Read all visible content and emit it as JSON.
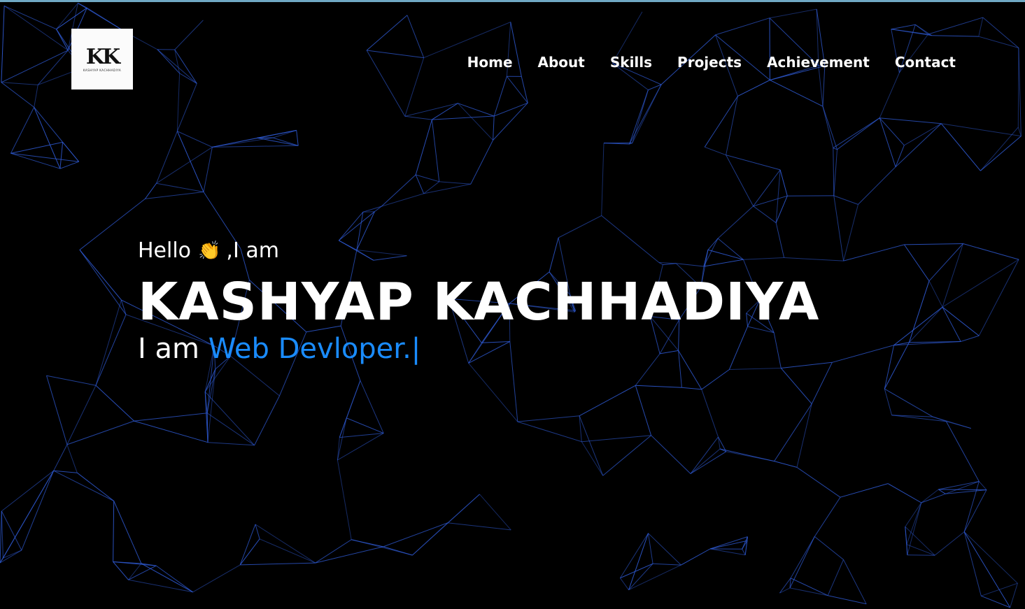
{
  "logo": {
    "mark": "KK",
    "subtitle": "KASHYAP KACHHADIYA"
  },
  "nav": {
    "items": [
      {
        "label": "Home"
      },
      {
        "label": "About"
      },
      {
        "label": "Skills"
      },
      {
        "label": "Projects"
      },
      {
        "label": "Achievement"
      },
      {
        "label": "Contact"
      }
    ]
  },
  "hero": {
    "greeting_before": "Hello",
    "greeting_icon": "👏",
    "greeting_after": ",I am",
    "name": "KASHYAP KACHHADIYA",
    "role_prefix": "I am",
    "role_text": "Web Devloper.",
    "cursor": "|"
  },
  "colors": {
    "background": "#000000",
    "accent": "#1a8cff",
    "network_lines": "#2f5bd6"
  }
}
